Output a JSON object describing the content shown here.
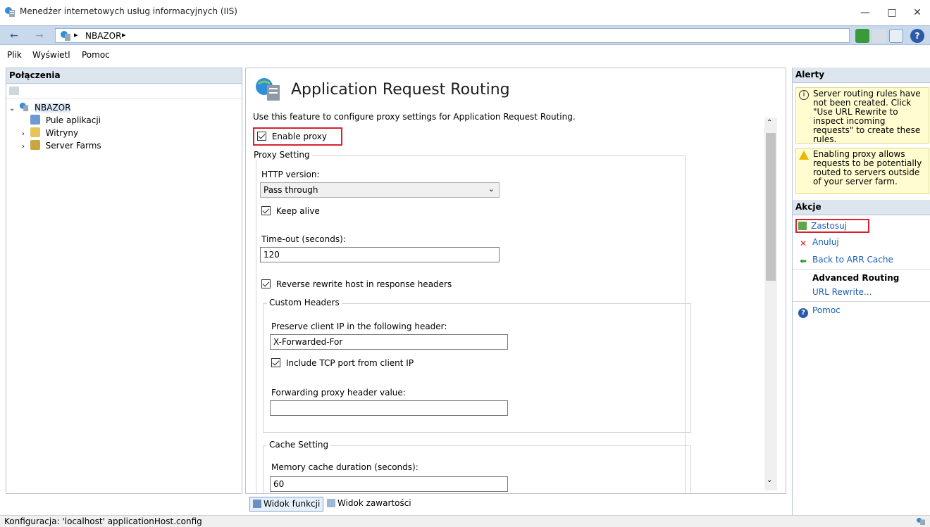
{
  "window": {
    "title": "Menedżer internetowych usług informacyjnych (IIS)",
    "minimize": "—",
    "maximize": "□",
    "close": "✕"
  },
  "address": {
    "back": "←",
    "forward": "→",
    "path": "NBAZOR",
    "separator": "▸"
  },
  "menu": {
    "items": [
      "Plik",
      "Wyświetl",
      "Pomoc"
    ]
  },
  "connections": {
    "header": "Połączenia",
    "tree": [
      {
        "label": "NBAZOR",
        "level": 0
      },
      {
        "label": "Pule aplikacji",
        "level": 1
      },
      {
        "label": "Witryny",
        "level": 1
      },
      {
        "label": "Server Farms",
        "level": 1
      }
    ]
  },
  "main": {
    "title": "Application Request Routing",
    "description": "Use this feature to configure proxy settings for Application Request Routing.",
    "enable_proxy": "Enable proxy",
    "proxy_setting": {
      "label": "Proxy Setting",
      "http_version_label": "HTTP version:",
      "http_version_value": "Pass through",
      "keep_alive": "Keep alive",
      "timeout_label": "Time-out (seconds):",
      "timeout_value": "120",
      "reverse_rewrite": "Reverse rewrite host in response headers"
    },
    "custom_headers": {
      "label": "Custom Headers",
      "preserve_label": "Preserve client IP in the following header:",
      "preserve_value": "X-Forwarded-For",
      "include_tcp": "Include TCP port from client IP",
      "forwarding_label": "Forwarding proxy header value:",
      "forwarding_value": ""
    },
    "cache_setting": {
      "label": "Cache Setting",
      "memory_label": "Memory cache duration (seconds):",
      "memory_value": "60"
    }
  },
  "view_tabs": {
    "features": "Widok funkcji",
    "content": "Widok zawartości"
  },
  "alerts": {
    "header": "Alerty",
    "items": [
      "Server routing rules have not been created. Click \"Use URL Rewrite to inspect incoming requests\" to create these rules.",
      "Enabling proxy allows requests to be potentially routed to servers outside of your server farm."
    ]
  },
  "actions": {
    "header": "Akcje",
    "apply": "Zastosuj",
    "cancel": "Anuluj",
    "back": "Back to ARR Cache",
    "advanced_header": "Advanced Routing",
    "url_rewrite": "URL Rewrite...",
    "help": "Pomoc"
  },
  "status": {
    "text": "Konfiguracja: 'localhost' applicationHost.config"
  },
  "colors": {
    "accent": "#1a5fb4",
    "highlight": "#d42030",
    "alert_bg": "#fffcd0"
  }
}
